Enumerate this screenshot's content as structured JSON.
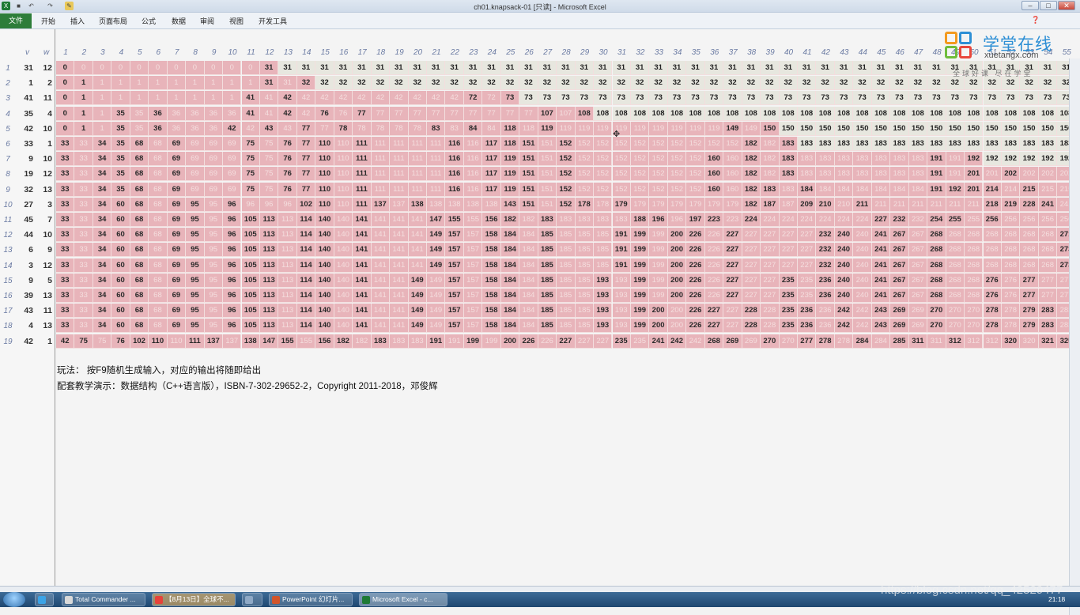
{
  "window": {
    "title": "ch01.knapsack-01  [只读] - Microsoft Excel"
  },
  "ribbon": {
    "file_tab": "文件",
    "tabs": [
      "开始",
      "插入",
      "页面布局",
      "公式",
      "数据",
      "审阅",
      "视图",
      "开发工具"
    ]
  },
  "grid": {
    "header_v": "v",
    "header_w": "w",
    "columns": [
      1,
      2,
      3,
      4,
      5,
      6,
      7,
      8,
      9,
      10,
      11,
      12,
      13,
      14,
      15,
      16,
      17,
      18,
      19,
      20,
      21,
      22,
      23,
      24,
      25,
      26,
      27,
      28,
      29,
      30,
      31,
      32,
      33,
      34,
      35,
      36,
      37,
      38,
      39,
      40,
      41,
      42,
      43,
      44,
      45,
      46,
      47,
      48,
      49,
      50,
      51,
      52,
      53,
      54,
      55
    ],
    "items": [
      {
        "n": 1,
        "v": 31,
        "w": 12
      },
      {
        "n": 2,
        "v": 1,
        "w": 2
      },
      {
        "n": 3,
        "v": 41,
        "w": 11
      },
      {
        "n": 4,
        "v": 35,
        "w": 4
      },
      {
        "n": 5,
        "v": 42,
        "w": 10
      },
      {
        "n": 6,
        "v": 33,
        "w": 1
      },
      {
        "n": 7,
        "v": 9,
        "w": 10
      },
      {
        "n": 8,
        "v": 19,
        "w": 12
      },
      {
        "n": 9,
        "v": 32,
        "w": 13
      },
      {
        "n": 10,
        "v": 27,
        "w": 3
      },
      {
        "n": 11,
        "v": 45,
        "w": 7
      },
      {
        "n": 12,
        "v": 44,
        "w": 10
      },
      {
        "n": 13,
        "v": 6,
        "w": 9
      },
      {
        "n": 14,
        "v": 3,
        "w": 12
      },
      {
        "n": 15,
        "v": 9,
        "w": 5
      },
      {
        "n": 16,
        "v": 39,
        "w": 13
      },
      {
        "n": 17,
        "v": 43,
        "w": 11
      },
      {
        "n": 18,
        "v": 4,
        "w": 13
      },
      {
        "n": 19,
        "v": 42,
        "w": 1
      }
    ]
  },
  "notes": {
    "line1": "玩法： 按F9随机生成输入，对应的输出将随即给出",
    "line2": "配套教学演示：数据结构（C++语言版），ISBN-7-302-29652-2，Copyright 2011-2018，邓俊辉"
  },
  "logo": {
    "cn": "学堂在线",
    "en": "xuetangx.com",
    "slogan": "全球好课 尽在学堂"
  },
  "taskbar": {
    "items": [
      "Total Commander ...",
      "【8月13日】全球不...",
      "PowerPoint 幻灯片...",
      "Microsoft Excel - c..."
    ],
    "clock": "21:18"
  },
  "watermark": "https://blog.csdn.net/qq_42529477"
}
